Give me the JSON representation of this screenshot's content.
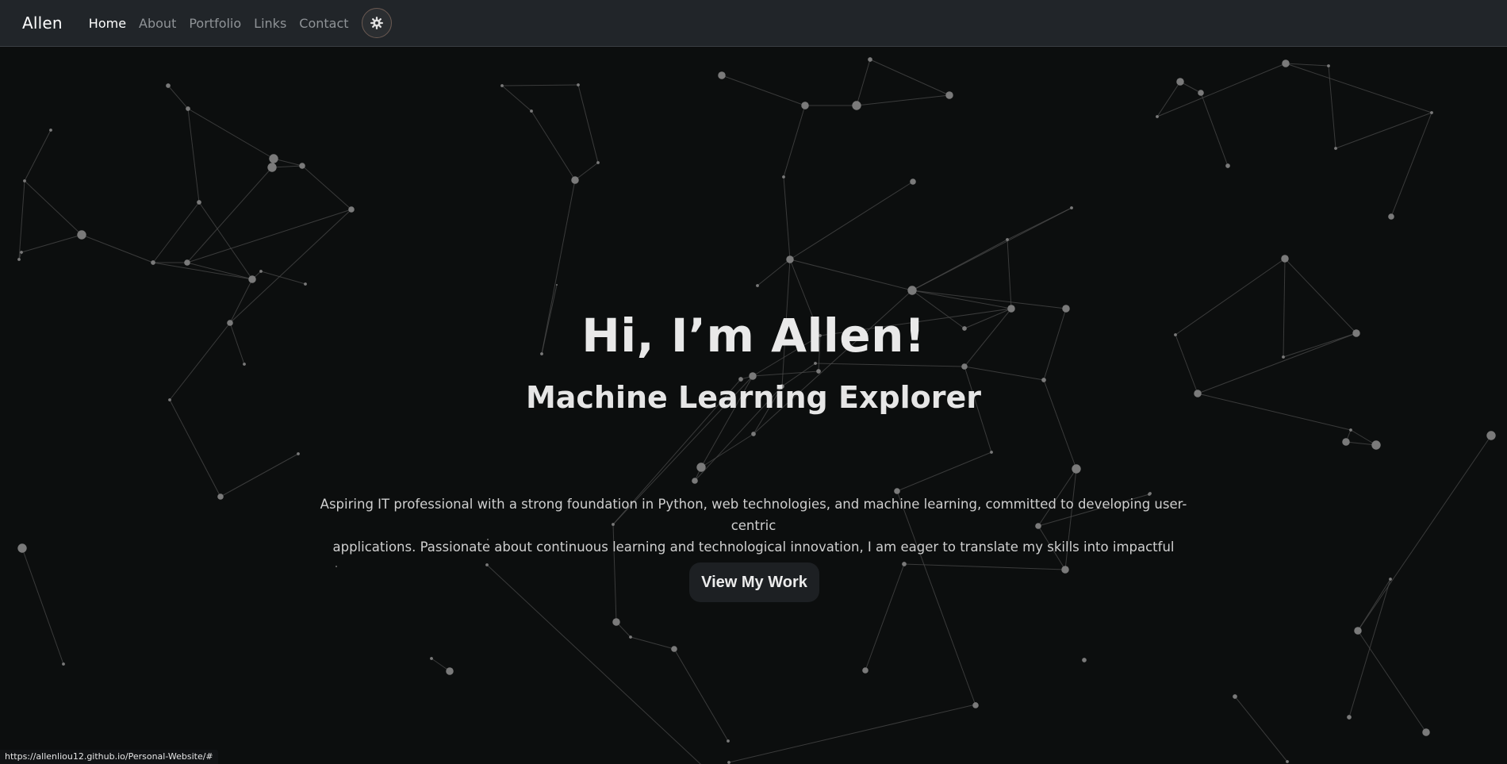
{
  "nav": {
    "brand": "Allen",
    "links": [
      {
        "label": "Home",
        "active": true
      },
      {
        "label": "About",
        "active": false
      },
      {
        "label": "Portfolio",
        "active": false
      },
      {
        "label": "Links",
        "active": false
      },
      {
        "label": "Contact",
        "active": false
      }
    ],
    "theme_icon": "gear-icon"
  },
  "hero": {
    "title": "Hi, I’m Allen!",
    "subtitle": "Machine Learning Explorer",
    "description_line1": "Aspiring IT professional with a strong foundation in Python, web technologies, and machine learning, committed to developing user-centric",
    "description_line2": "applications. Passionate about continuous learning and technological innovation, I am eager to translate my skills into impactful solutions.",
    "cta_label": "View My Work"
  },
  "status_bar": {
    "url": "https://allenliou12.github.io/Personal-Website/#"
  },
  "colors": {
    "background": "#0c0e0e",
    "navbar": "#212529",
    "particle": "#7a7a7a",
    "line": "#4a4a4a"
  }
}
